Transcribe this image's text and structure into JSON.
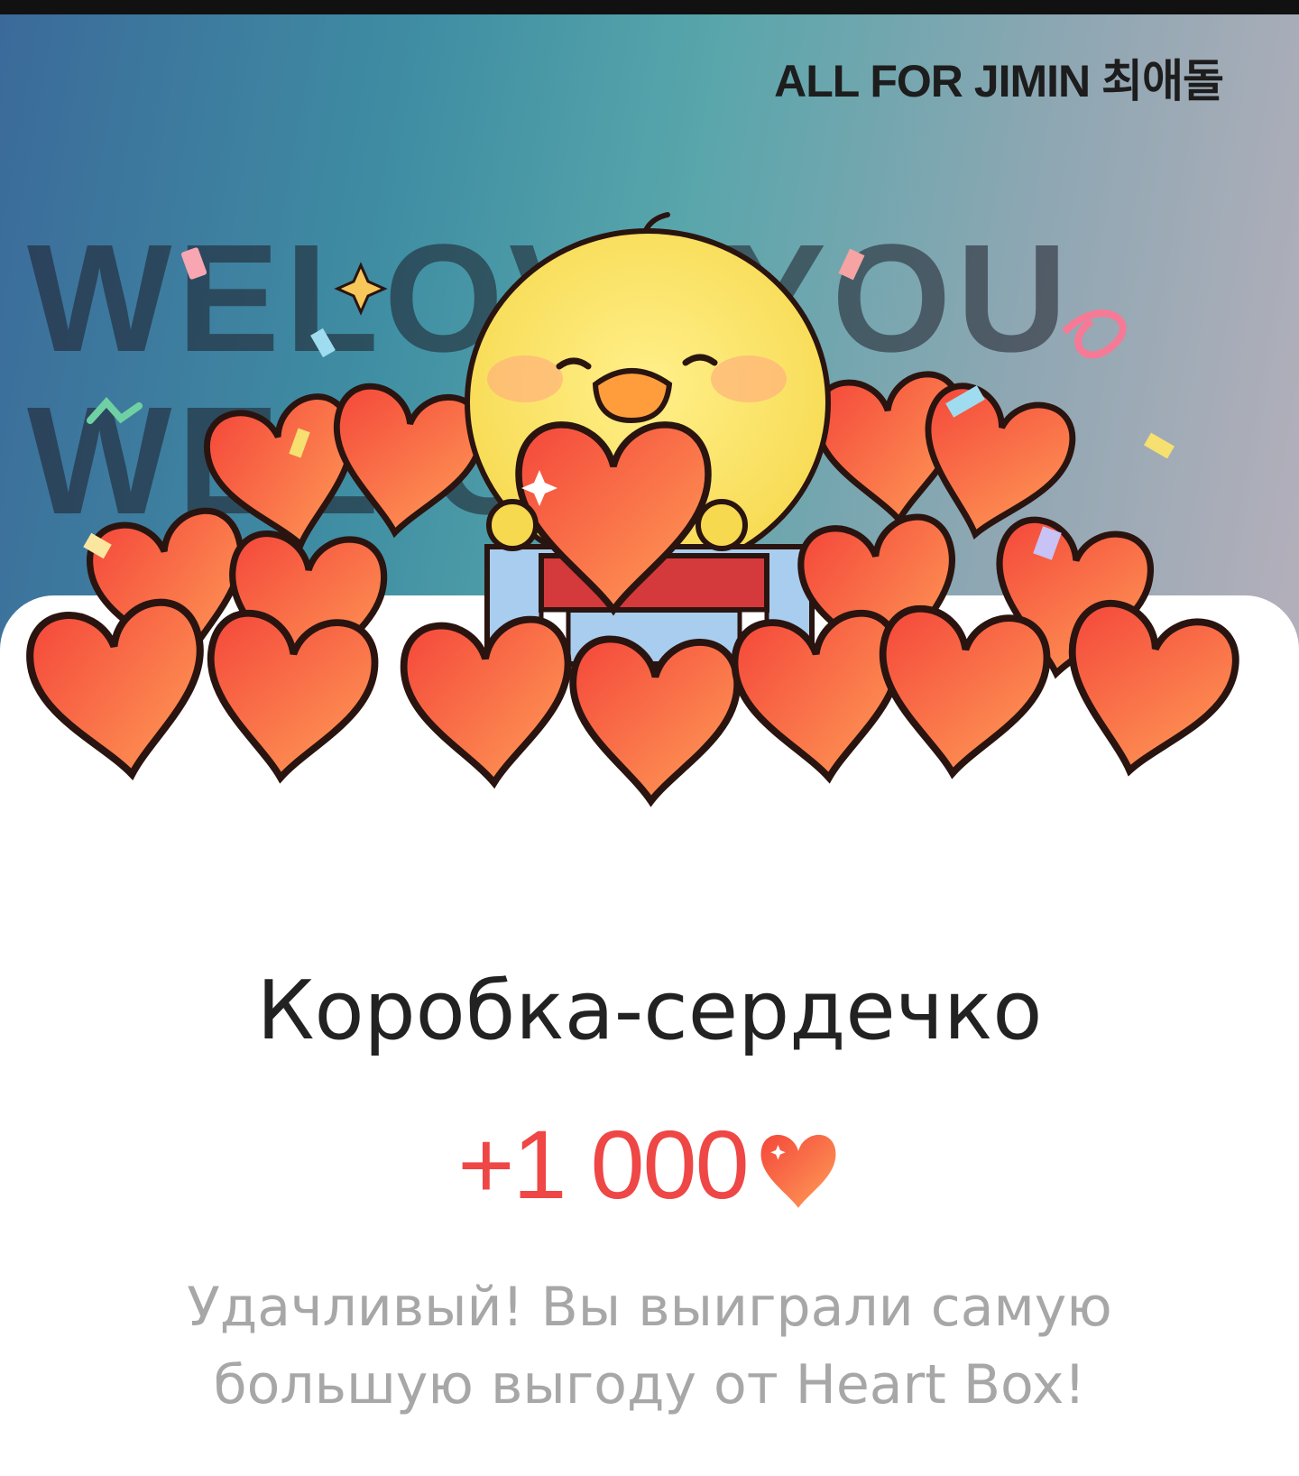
{
  "banner": {
    "brand_text": "ALL FOR JIMIN 최애돌",
    "background_line1": "WELOVEYOU",
    "background_line2": "WEL    OU"
  },
  "reward": {
    "title": "Коробка-сердечко",
    "amount": "+1 000",
    "currency_icon": "heart-icon",
    "message": "Удачливый! Вы выиграли самую большую выгоду от Heart Box!"
  },
  "colors": {
    "accent": "#ef4646",
    "heart_fill_start": "#f4513f",
    "heart_fill_end": "#ff9b55",
    "title_text": "#222222",
    "message_text": "#a7a7a7"
  }
}
